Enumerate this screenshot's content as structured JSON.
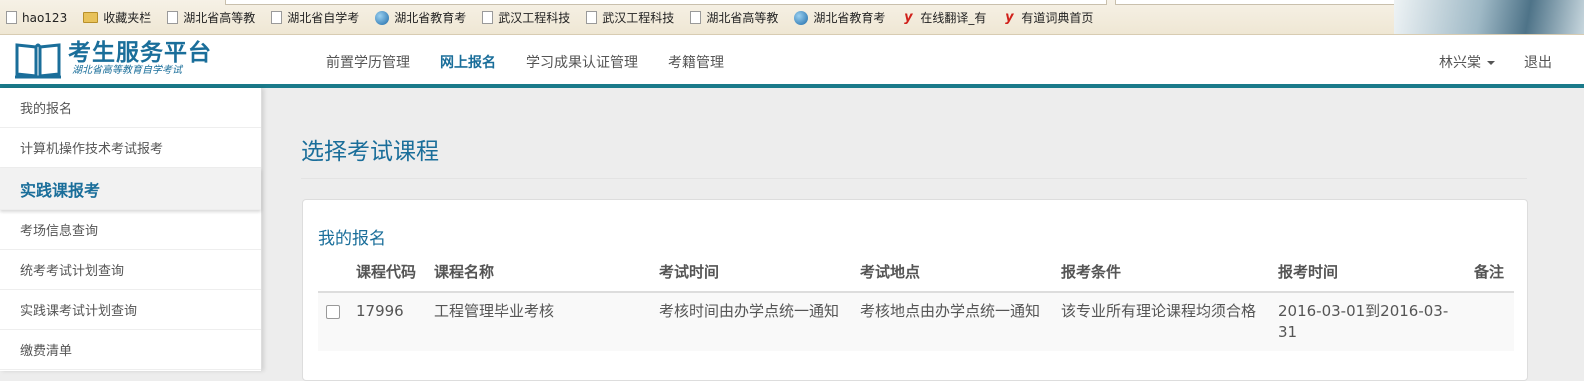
{
  "bookmarks": [
    {
      "label": "hao123",
      "icon": "page-icon"
    },
    {
      "label": "收藏夹栏",
      "icon": "folder-icon"
    },
    {
      "label": "湖北省高等教",
      "icon": "page-icon"
    },
    {
      "label": "湖北省自学考",
      "icon": "page-icon"
    },
    {
      "label": "湖北省教育考",
      "icon": "globe-icon"
    },
    {
      "label": "武汉工程科技",
      "icon": "page-icon"
    },
    {
      "label": "武汉工程科技",
      "icon": "page-icon"
    },
    {
      "label": "湖北省高等教",
      "icon": "page-icon"
    },
    {
      "label": "湖北省教育考",
      "icon": "globe-icon"
    },
    {
      "label": "在线翻译_有",
      "icon": "youdao-icon"
    },
    {
      "label": "有道词典首页",
      "icon": "youdao-icon"
    }
  ],
  "header": {
    "logo_title": "考生服务平台",
    "logo_subtitle": "湖北省高等教育自学考试",
    "nav": [
      "前置学历管理",
      "网上报名",
      "学习成果认证管理",
      "考籍管理"
    ],
    "nav_active": "网上报名",
    "user": "林兴棠",
    "logout": "退出"
  },
  "sidebar": {
    "items": [
      {
        "label": "我的报名",
        "active": false
      },
      {
        "label": "计算机操作技术考试报考",
        "active": false
      },
      {
        "label": "实践课报考",
        "active": true
      },
      {
        "label": "考场信息查询",
        "active": false
      },
      {
        "label": "统考考试计划查询",
        "active": false
      },
      {
        "label": "实践课考试计划查询",
        "active": false
      },
      {
        "label": "缴费清单",
        "active": false
      }
    ]
  },
  "main": {
    "page_title": "选择考试课程",
    "panel_title": "我的报名",
    "columns": [
      "课程代码",
      "课程名称",
      "考试时间",
      "考试地点",
      "报考条件",
      "报考时间",
      "备注"
    ],
    "rows": [
      {
        "code": "17996",
        "name": "工程管理毕业考核",
        "time": "考核时间由办学点统一通知",
        "place": "考核地点由办学点统一通知",
        "condition": "该专业所有理论课程均须合格",
        "period": "2016-03-01到2016-03-31",
        "remark": ""
      }
    ]
  },
  "colors": {
    "accent": "#1a6e9a",
    "header_rule": "#1a7a8a"
  }
}
